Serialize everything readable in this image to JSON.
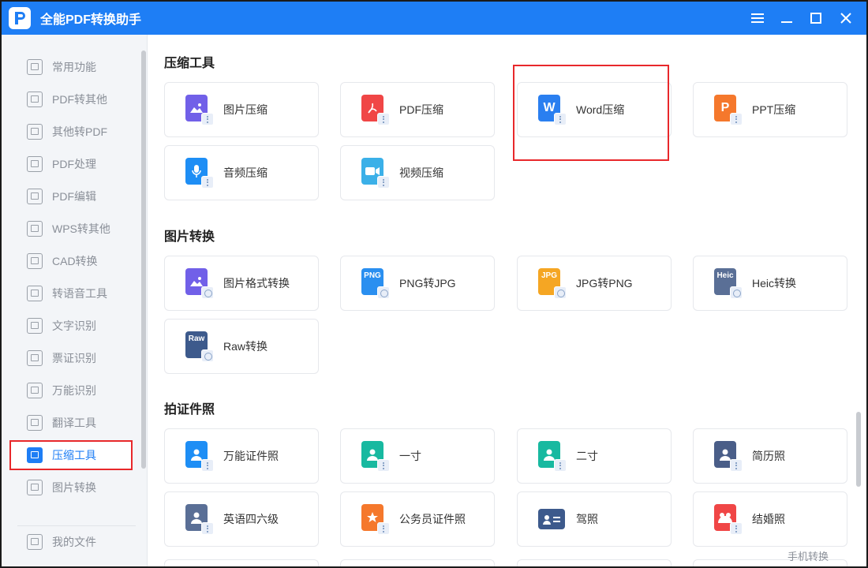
{
  "app": {
    "title": "全能PDF转换助手"
  },
  "colors": {
    "accent": "#1e7ef5",
    "highlight": "#e8282b"
  },
  "sidebar": {
    "items": [
      {
        "label": "常用功能",
        "icon": "home-grid-icon"
      },
      {
        "label": "PDF转其他",
        "icon": "pdf-export-icon"
      },
      {
        "label": "其他转PDF",
        "icon": "pdf-import-icon"
      },
      {
        "label": "PDF处理",
        "icon": "pdf-process-icon"
      },
      {
        "label": "PDF编辑",
        "icon": "pdf-edit-icon"
      },
      {
        "label": "WPS转其他",
        "icon": "wps-icon"
      },
      {
        "label": "CAD转换",
        "icon": "cad-icon"
      },
      {
        "label": "转语音工具",
        "icon": "voice-icon"
      },
      {
        "label": "文字识别",
        "icon": "ocr-icon"
      },
      {
        "label": "票证识别",
        "icon": "ticket-icon"
      },
      {
        "label": "万能识别",
        "icon": "eye-icon"
      },
      {
        "label": "翻译工具",
        "icon": "translate-icon"
      },
      {
        "label": "压缩工具",
        "icon": "zip-icon",
        "active": true
      },
      {
        "label": "图片转换",
        "icon": "image-convert-icon"
      }
    ],
    "my_files": "我的文件"
  },
  "sections": [
    {
      "title": "压缩工具",
      "cards": [
        {
          "label": "图片压缩",
          "icon": "image-compress-icon",
          "color": "#7160e8",
          "text": ""
        },
        {
          "label": "PDF压缩",
          "icon": "pdf-compress-icon",
          "color": "#f04646",
          "text": ""
        },
        {
          "label": "Word压缩",
          "icon": "word-compress-icon",
          "color": "#2a7ff0",
          "text": "W"
        },
        {
          "label": "PPT压缩",
          "icon": "ppt-compress-icon",
          "color": "#f5782c",
          "text": "P"
        },
        {
          "label": "音频压缩",
          "icon": "audio-compress-icon",
          "color": "#1e8ef5",
          "text": ""
        },
        {
          "label": "视频压缩",
          "icon": "video-compress-icon",
          "color": "#3bb0e8",
          "text": ""
        }
      ]
    },
    {
      "title": "图片转换",
      "cards": [
        {
          "label": "图片格式转换",
          "icon": "image-format-icon",
          "color": "#7160e8",
          "text": ""
        },
        {
          "label": "PNG转JPG",
          "icon": "png-icon",
          "color": "#2a8ff0",
          "text": "PNG"
        },
        {
          "label": "JPG转PNG",
          "icon": "jpg-icon",
          "color": "#f5a623",
          "text": "JPG"
        },
        {
          "label": "Heic转换",
          "icon": "heic-icon",
          "color": "#5a6f96",
          "text": "Heic"
        },
        {
          "label": "Raw转换",
          "icon": "raw-icon",
          "color": "#3d5a8c",
          "text": "Raw"
        }
      ]
    },
    {
      "title": "拍证件照",
      "cards": [
        {
          "label": "万能证件照",
          "icon": "id-photo-icon",
          "color": "#1e8ef5",
          "text": ""
        },
        {
          "label": "一寸",
          "icon": "one-inch-icon",
          "color": "#18b9a0",
          "text": ""
        },
        {
          "label": "二寸",
          "icon": "two-inch-icon",
          "color": "#18b9a0",
          "text": ""
        },
        {
          "label": "简历照",
          "icon": "resume-photo-icon",
          "color": "#4a5e88",
          "text": ""
        },
        {
          "label": "英语四六级",
          "icon": "cet-icon",
          "color": "#5a6f96",
          "text": ""
        },
        {
          "label": "公务员证件照",
          "icon": "civil-servant-icon",
          "color": "#f5782c",
          "text": ""
        },
        {
          "label": "驾照",
          "icon": "driver-license-icon",
          "color": "#3d5a8c",
          "text": ""
        },
        {
          "label": "结婚照",
          "icon": "wedding-photo-icon",
          "color": "#f04646",
          "text": ""
        }
      ]
    }
  ],
  "footer": {
    "mobile_convert": "手机转换"
  }
}
